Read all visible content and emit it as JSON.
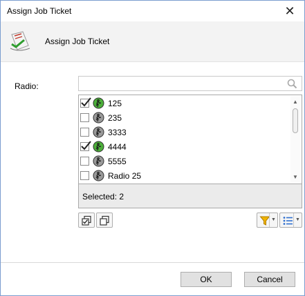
{
  "window": {
    "title": "Assign Job Ticket",
    "close_label": "✕"
  },
  "header": {
    "title": "Assign Job Ticket",
    "icon": "assign-ticket-icon"
  },
  "form": {
    "radio_label": "Radio:",
    "search": {
      "value": "",
      "placeholder": ""
    },
    "items": [
      {
        "label": "125",
        "checked": true,
        "status": "available"
      },
      {
        "label": "235",
        "checked": false,
        "status": "unavailable"
      },
      {
        "label": "3333",
        "checked": false,
        "status": "unavailable"
      },
      {
        "label": "4444",
        "checked": true,
        "status": "available"
      },
      {
        "label": "5555",
        "checked": false,
        "status": "unavailable"
      },
      {
        "label": "Radio 25",
        "checked": false,
        "status": "unavailable"
      }
    ],
    "selected_text": "Selected: 2"
  },
  "toolbar": {
    "select_all_icon": "select-all-icon",
    "deselect_all_icon": "deselect-all-icon",
    "filter_icon": "filter-icon",
    "list_view_icon": "list-view-icon"
  },
  "buttons": {
    "ok": "OK",
    "cancel": "Cancel"
  },
  "colors": {
    "available": "#4caf3a",
    "unavailable": "#9a9a9a",
    "filter": "#f0b400",
    "list_icon": "#2f6fcf"
  }
}
